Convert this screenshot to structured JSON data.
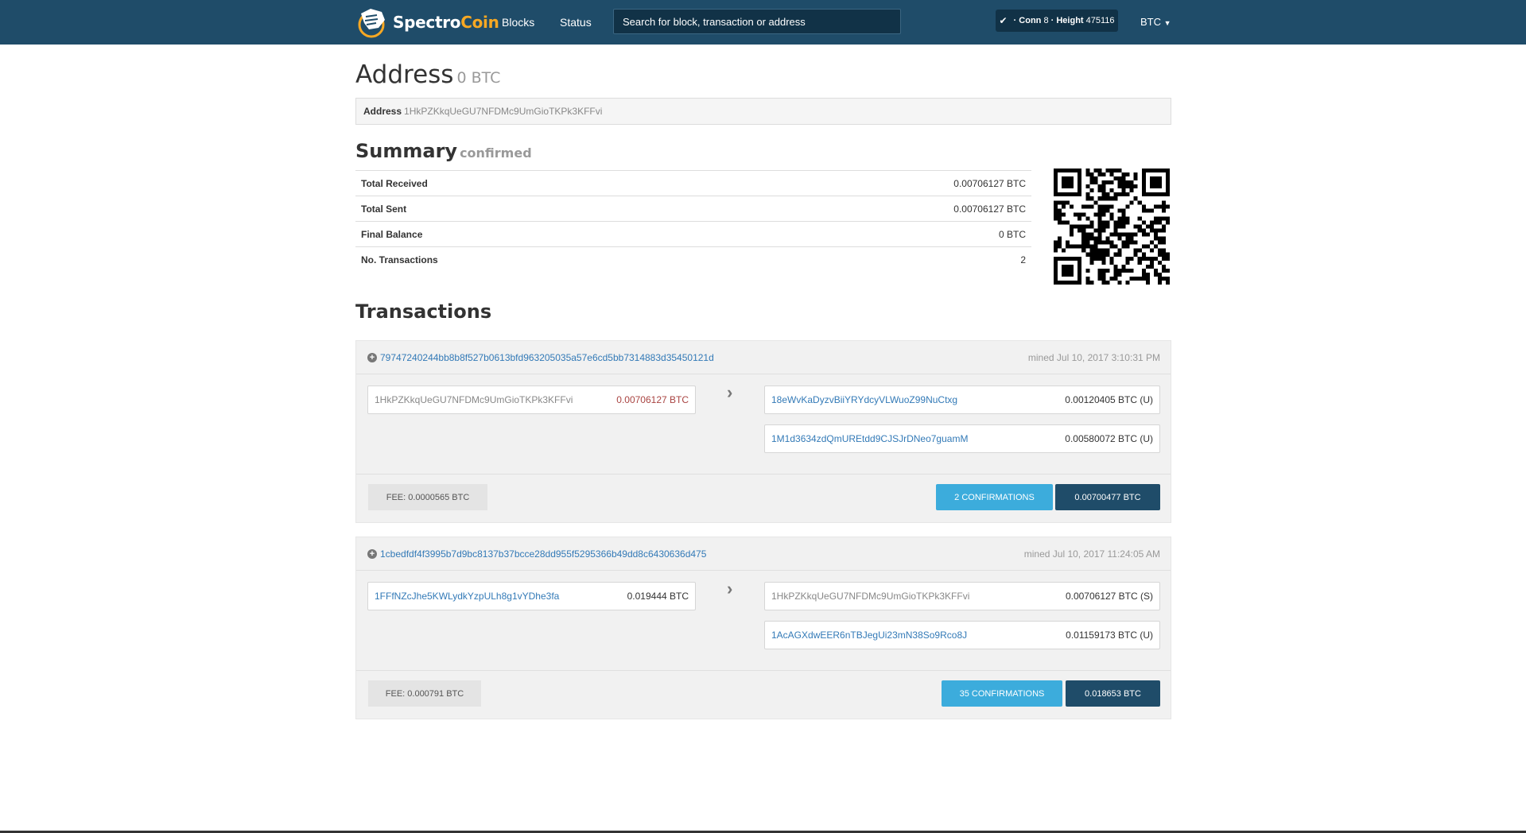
{
  "nav": {
    "logo_spectro": "Spectro",
    "logo_coin": "Coin",
    "blocks": "Blocks",
    "status": "Status",
    "search_placeholder": "Search for block, transaction or address",
    "conn_label": "Conn",
    "conn_value": "8",
    "height_label": "Height",
    "height_value": "475116",
    "currency": "BTC"
  },
  "address": {
    "title": "Address",
    "balance": "0 BTC",
    "label": "Address",
    "value": "1HkPZKkqUeGU7NFDMc9UmGioTKPk3KFFvi"
  },
  "summary": {
    "title": "Summary",
    "status": "confirmed",
    "rows": [
      {
        "label": "Total Received",
        "value": "0.00706127 BTC"
      },
      {
        "label": "Total Sent",
        "value": "0.00706127 BTC"
      },
      {
        "label": "Final Balance",
        "value": "0 BTC"
      },
      {
        "label": "No. Transactions",
        "value": "2"
      }
    ]
  },
  "transactions": {
    "title": "Transactions",
    "items": [
      {
        "hash": "79747240244bb8b8f527b0613bfd963205035a57e6cd5bb7314883d35450121d",
        "mined": "mined Jul 10, 2017 3:10:31 PM",
        "inputs": [
          {
            "address": "1HkPZKkqUeGU7NFDMc9UmGioTKPk3KFFvi",
            "amount": "0.00706127 BTC"
          }
        ],
        "outputs": [
          {
            "address": "18eWvKaDyzvBiiYRYdcyVLWuoZ99NuCtxg",
            "amount": "0.00120405 BTC (U)"
          },
          {
            "address": "1M1d3634zdQmUREtdd9CJSJrDNeo7guamM",
            "amount": "0.00580072 BTC (U)"
          }
        ],
        "fee": "FEE: 0.0000565 BTC",
        "confirmations": "2 CONFIRMATIONS",
        "total": "0.00700477 BTC"
      },
      {
        "hash": "1cbedfdf4f3995b7d9bc8137b37bcce28dd955f5295366b49dd8c6430636d475",
        "mined": "mined Jul 10, 2017 11:24:05 AM",
        "inputs": [
          {
            "address": "1FFfNZcJhe5KWLydkYzpULh8g1vYDhe3fa",
            "amount": "0.019444 BTC"
          }
        ],
        "outputs": [
          {
            "address": "1HkPZKkqUeGU7NFDMc9UmGioTKPk3KFFvi",
            "amount": "0.00706127 BTC (S)"
          },
          {
            "address": "1AcAGXdwEER6nTBJegUi23mN38So9Rco8J",
            "amount": "0.01159173 BTC (U)"
          }
        ],
        "fee": "FEE: 0.000791 BTC",
        "confirmations": "35 CONFIRMATIONS",
        "total": "0.018653 BTC"
      }
    ]
  },
  "colors": {
    "navbar": "#1f4c69",
    "brand_accent": "#f7a823",
    "link": "#337ab7",
    "confirm_button": "#3cacdc",
    "total_button": "#1f4c69"
  },
  "icons": {
    "logo": "spectrocoin-logo-icon",
    "check": "check-icon",
    "caret": "caret-down-icon",
    "expand": "plus-circle-icon",
    "arrow": "chevron-right-icon",
    "qr": "qr-code-icon"
  }
}
